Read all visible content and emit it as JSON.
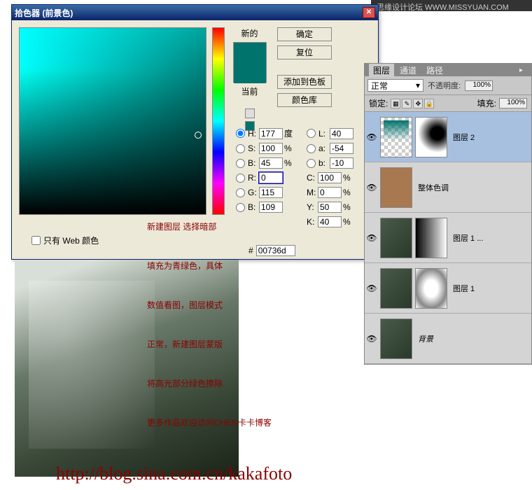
{
  "header": "思缘设计论坛  WWW.MISSYUAN.COM",
  "dialog": {
    "title": "拾色器 (前景色)",
    "close": "✕",
    "new_label": "新的",
    "current_label": "当前",
    "buttons": {
      "ok": "确定",
      "cancel": "复位",
      "add": "添加到色板",
      "library": "颜色库"
    },
    "channels": {
      "H": {
        "label": "H:",
        "value": "177",
        "unit": "度"
      },
      "S": {
        "label": "S:",
        "value": "100",
        "unit": "%"
      },
      "B": {
        "label": "B:",
        "value": "45",
        "unit": "%"
      },
      "R": {
        "label": "R:",
        "value": "0",
        "unit": ""
      },
      "G": {
        "label": "G:",
        "value": "115",
        "unit": ""
      },
      "Bb": {
        "label": "B:",
        "value": "109",
        "unit": ""
      },
      "L": {
        "label": "L:",
        "value": "40",
        "unit": ""
      },
      "a": {
        "label": "a:",
        "value": "-54",
        "unit": ""
      },
      "b": {
        "label": "b:",
        "value": "-10",
        "unit": ""
      },
      "C": {
        "label": "C:",
        "value": "100",
        "unit": "%"
      },
      "M": {
        "label": "M:",
        "value": "0",
        "unit": "%"
      },
      "Y": {
        "label": "Y:",
        "value": "50",
        "unit": "%"
      },
      "K": {
        "label": "K:",
        "value": "40",
        "unit": "%"
      }
    },
    "hex": {
      "label": "#",
      "value": "00736d"
    },
    "web_only": "只有 Web 颜色"
  },
  "panel": {
    "tabs": [
      "图层",
      "通道",
      "路径"
    ],
    "blend_mode": "正常",
    "opacity_label": "不透明度:",
    "opacity": "100%",
    "lock_label": "锁定:",
    "fill_label": "填充:",
    "fill": "100%",
    "layers": [
      {
        "name": "图层 2"
      },
      {
        "name": "整体色调"
      },
      {
        "name": "图层 1 ..."
      },
      {
        "name": "图层 1"
      },
      {
        "name": "背景"
      }
    ]
  },
  "overlay": {
    "l1": "新建图层 选择暗部",
    "l2": "填充为青绿色，具体",
    "l3": "数值看图，图层模式",
    "l4": "正常，新建图层蒙版",
    "l5": "将高光部分绿色擦除",
    "l6": "更多作品欢迎访问CHEN卡卡博客"
  },
  "url": "http://blog.sina.com.cn/kakafoto"
}
